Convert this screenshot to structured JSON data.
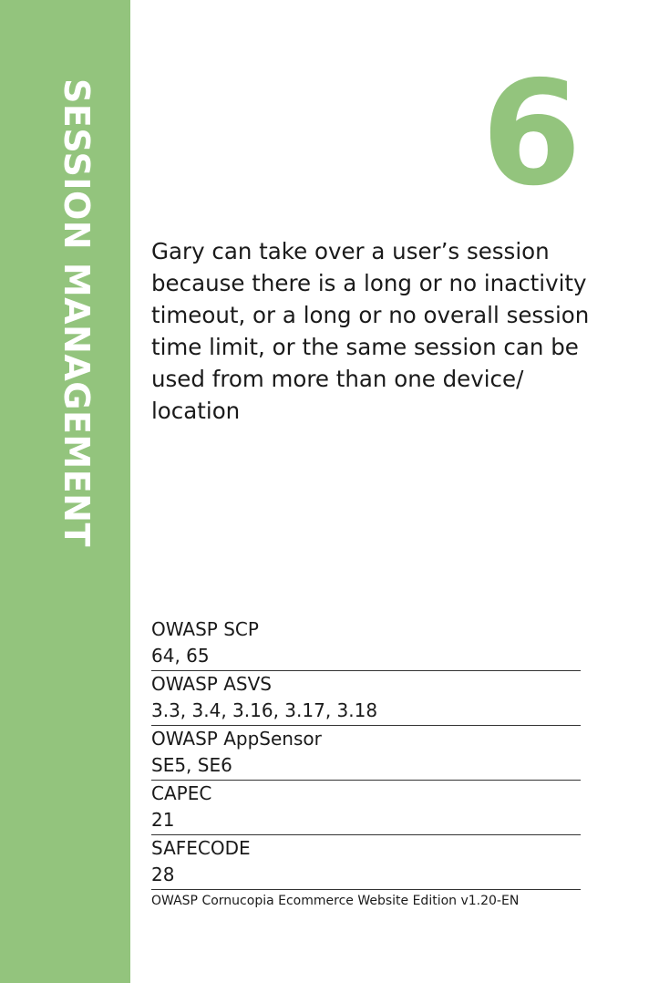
{
  "card": {
    "category": "SESSION MANAGEMENT",
    "number": "6",
    "description": "Gary can take over a user’s session because there is a long or no inactivity timeout, or a long or no overall session time limit, or the same session can be used from more than one device/ location",
    "references": [
      {
        "label": "OWASP SCP",
        "value": "64, 65"
      },
      {
        "label": "OWASP ASVS",
        "value": "3.3, 3.4, 3.16, 3.17, 3.18"
      },
      {
        "label": "OWASP AppSensor",
        "value": "SE5, SE6"
      },
      {
        "label": "CAPEC",
        "value": "21"
      },
      {
        "label": "SAFECODE",
        "value": "28"
      }
    ],
    "footer": "OWASP Cornucopia Ecommerce Website Edition v1.20-EN"
  },
  "colors": {
    "accent": "#93c47d",
    "text": "#1a1a1a",
    "background": "#ffffff"
  }
}
